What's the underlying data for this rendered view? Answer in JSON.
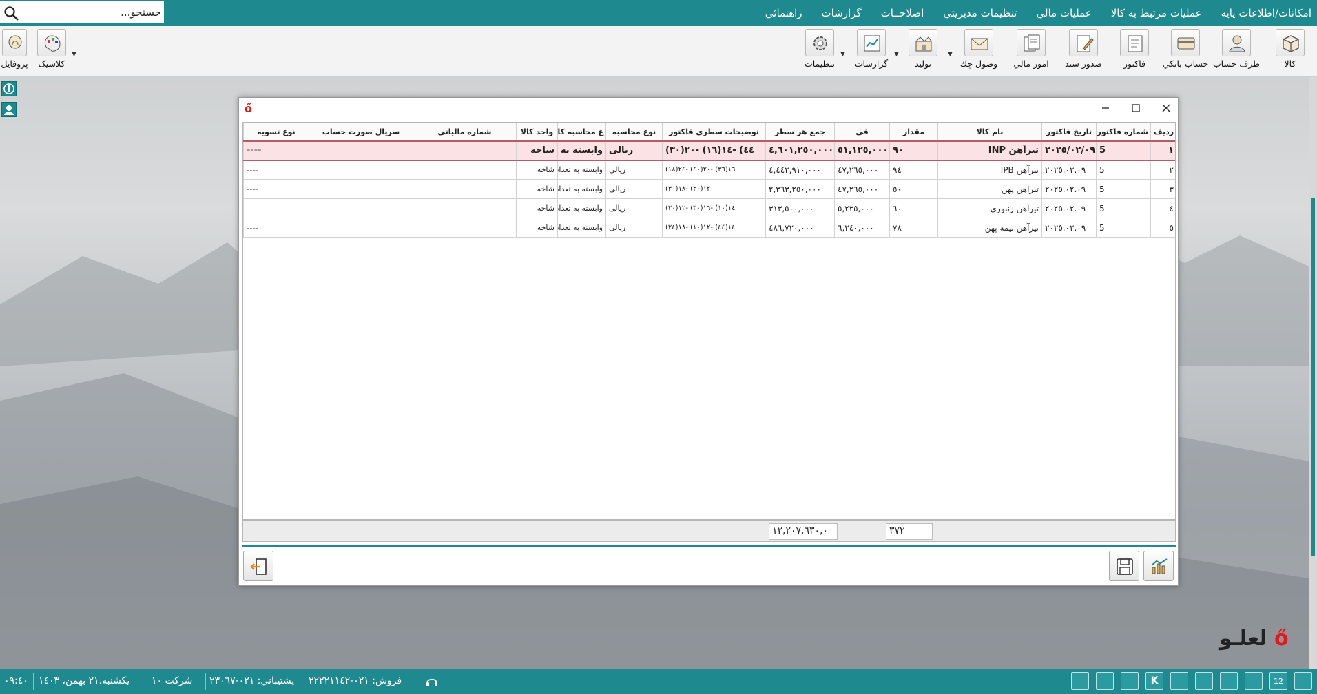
{
  "menu": {
    "items": [
      "امکانات/اطلاعات پايه",
      "عمليات مرتبط به کالا",
      "عمليات مالي",
      "تنظيمات مديريتي",
      "اصلاحــات",
      "گزارشات",
      "راهنمائي"
    ],
    "search_placeholder": "جستجو..."
  },
  "toolbar": {
    "items": [
      "کالا",
      "طرف حساب",
      "حساب بانکي",
      "فاکتور",
      "صدور سند",
      "امور مالي",
      "وصول چك",
      "توليد",
      "گزارشات",
      "تنظيمات"
    ],
    "left_items": [
      "کلاسیک",
      "پروفایل"
    ]
  },
  "grid": {
    "columns": [
      "رديف",
      "شماره فاكتور",
      "تاريخ فاكتور",
      "نام كالا",
      "مقدار",
      "فی",
      "جمع هر سطر",
      "توضيحات سطری فاكتور",
      "نوع محاسبه",
      "ع محاسبه كالا",
      "واحد كالا",
      "شماره مالياتی",
      "سريال صورت حساب",
      "نوع تسويه"
    ],
    "rows": [
      {
        "idx": "١",
        "invoice": "5",
        "date": "٢٠٢٥/٠٢/٠٩",
        "product": "تيرآهن INP",
        "qty": "٩٠",
        "price": "٥١,١٢٥,٠٠٠",
        "total": "٤,٦٠١,٢٥٠,٠٠٠",
        "desc": "٤٤) -١٤(١٦) -٢٠(٣٠)",
        "calc_type": "ريالی",
        "calc_base": "وابسته به تعداد",
        "unit": "شاخه",
        "tax_no": "",
        "serial": "",
        "settle": "----"
      },
      {
        "idx": "٢",
        "invoice": "5",
        "date": "٢٠٢٥.٠٢.٠٩",
        "product": "تيرآهن IPB",
        "qty": "٩٤",
        "price": "٤٧,٢٦٥,٠٠٠",
        "total": "٤,٤٤٢,٩١٠,٠٠٠",
        "desc": "١٦(٣٦) -٢٠(٤٠) -٢٤(١٨)",
        "calc_type": "ريالی",
        "calc_base": "وابسته به تعداد",
        "unit": "شاخه",
        "tax_no": "",
        "serial": "",
        "settle": "----"
      },
      {
        "idx": "٣",
        "invoice": "5",
        "date": "٢٠٢٥.٠٢.٠٩",
        "product": "تيرآهن پهن",
        "qty": "٥٠",
        "price": "٤٧,٢٦٥,٠٠٠",
        "total": "٢,٣٦٣,٢٥٠,٠٠٠",
        "desc": "١٢(٢٠) -١٨(٣٠)",
        "calc_type": "ريالی",
        "calc_base": "وابسته به تعداد",
        "unit": "شاخه",
        "tax_no": "",
        "serial": "",
        "settle": "----"
      },
      {
        "idx": "٤",
        "invoice": "5",
        "date": "٢٠٢٥.٠٢.٠٩",
        "product": "تيرآهن زنبوری",
        "qty": "٦٠",
        "price": "٥,٢٢٥,٠٠٠",
        "total": "٣١٣,٥٠٠,٠٠٠",
        "desc": "١٤(١٠) -١٦(٣٠) -١٢(٢٠)",
        "calc_type": "ريالی",
        "calc_base": "وابسته به تعداد",
        "unit": "شاخه",
        "tax_no": "",
        "serial": "",
        "settle": "----"
      },
      {
        "idx": "٥",
        "invoice": "5",
        "date": "٢٠٢٥.٠٢.٠٩",
        "product": "تيرآهن نيمه پهن",
        "qty": "٧٨",
        "price": "٦,٢٤٠,٠٠٠",
        "total": "٤٨٦,٧٢٠,٠٠٠",
        "desc": "١٤(٤٤) -١٢(١٠) -١٨(٢٤)",
        "calc_type": "ريالی",
        "calc_base": "وابسته به تعداد",
        "unit": "شاخه",
        "tax_no": "",
        "serial": "",
        "settle": "----"
      }
    ],
    "total_amount": "١٢,٢٠٧,٦٣٠,٠",
    "total_qty": "٣٧٢"
  },
  "brand": "لعلـو",
  "status": {
    "sales": "فروش: ٠٢١-٢٢٢٢١١٤٢",
    "support": "پشتيباني: ٠٢١-٢٣٠٦٧",
    "company": "شرکت ١٠",
    "date": "يكشنبه،٢١ بهمن، ١٤٠٣",
    "time": "٠٩:٤٠",
    "calendar_day": "12"
  },
  "colors": {
    "accent": "#1e8a8f",
    "selected_row": "#fbe3e5",
    "brand_red": "#e01b1b"
  }
}
